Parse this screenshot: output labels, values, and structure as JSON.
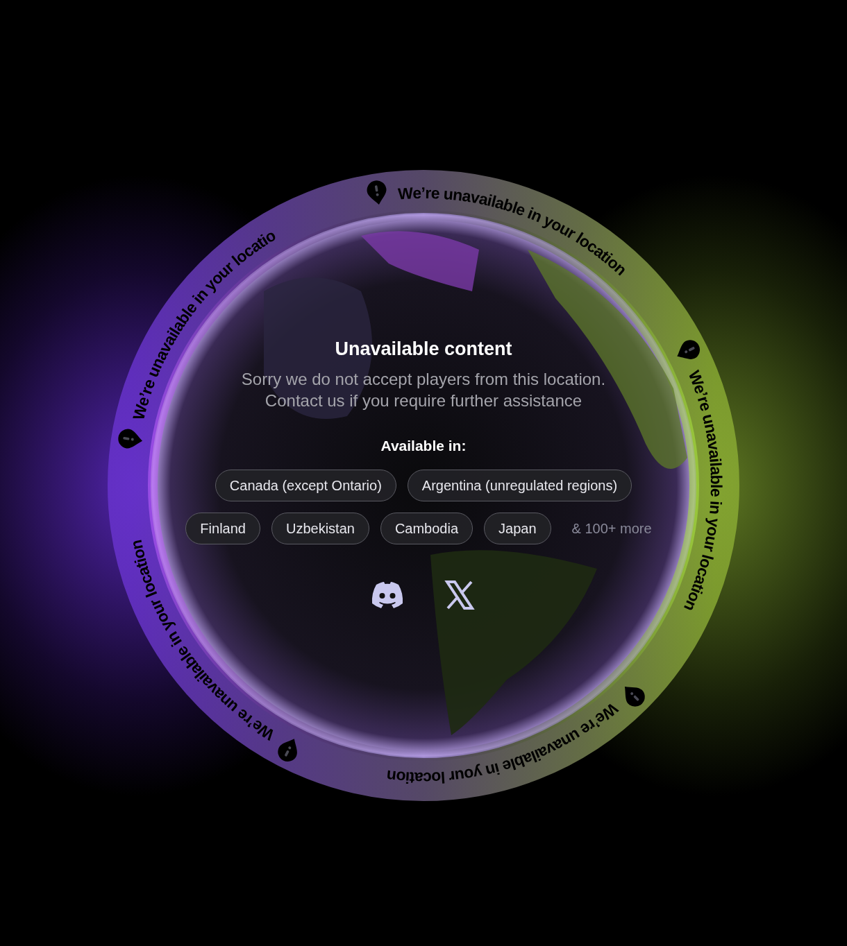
{
  "ring_texts": [
    "We’re unavailable in your location",
    "We’re unavailable in your locatio",
    "We’re unavailable in your location",
    "We’re unavailable in your location",
    "We’re unavailable in your location"
  ],
  "title": "Unavailable content",
  "message_lines": [
    "Sorry we do not accept players from this location.",
    "Contact us if you require further assistance"
  ],
  "available_label": "Available in:",
  "region_rows": [
    [
      "Canada (except Ontario)",
      "Argentina (unregulated regions)"
    ],
    [
      "Finland",
      "Uzbekistan",
      "Cambodia",
      "Japan"
    ]
  ],
  "more": "& 100+ more",
  "social_links": [
    {
      "kind": "discord"
    },
    {
      "kind": "x"
    }
  ]
}
